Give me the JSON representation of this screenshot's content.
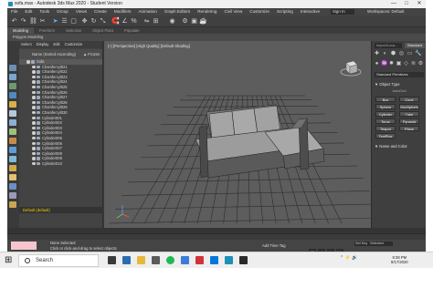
{
  "window": {
    "title": "sofa.max - Autodesk 3ds Max 2020 - Student Version",
    "controls": [
      "—",
      "□",
      "✕"
    ]
  },
  "menubar": {
    "items": [
      "File",
      "Edit",
      "Tools",
      "Group",
      "Views",
      "Create",
      "Modifiers",
      "Animation",
      "Graph Editors",
      "Rendering",
      "Civil View",
      "Customize",
      "Scripting",
      "Interactive"
    ],
    "signin": "Sign In",
    "workspace": "Workspaces: Default"
  },
  "ribbon": {
    "tabs": [
      "Modeling",
      "Freeform",
      "Selection",
      "Object Paint",
      "Populate"
    ],
    "active_tab": "Modeling",
    "panel_label": "Polygon Modeling"
  },
  "scene_explorer": {
    "tabs": [
      "Select",
      "Display",
      "Edit",
      "Customize"
    ],
    "col_name": "Name (Sorted Ascending)",
    "col_frozen": "▲ Frozen",
    "root": "Sofa",
    "items": [
      "Chamfercyl021",
      "Chamfercyl022",
      "Chamfercyl023",
      "Chamfercyl024",
      "Chamfercyl025",
      "Chamfercyl026",
      "Chamfercyl027",
      "Chamfercyl028",
      "Chamfercyl029",
      "Chamfercyl030",
      "Cylinder001",
      "Cylinder002",
      "Cylinder003",
      "Cylinder004",
      "Cylinder005",
      "Cylinder006",
      "Cylinder007",
      "Cylinder008",
      "Cylinder009",
      "Cylinder010"
    ],
    "layer": "Default (default)"
  },
  "viewport": {
    "label": "[+] [Perspective] [High Quality] [Default Shading]"
  },
  "command_panel": {
    "search": "Import/Loca...",
    "tab": "Standard",
    "dropdown": "Standard Primitives",
    "object_type": "▼ Object Type",
    "autogrid": "AutoGrid",
    "buttons": [
      "Box",
      "Cone",
      "Sphere",
      "GeoSphere",
      "Cylinder",
      "Tube",
      "Torus",
      "Pyramid",
      "Teapot",
      "Plane",
      "TextPlus"
    ],
    "name_color": "▼ Name and Color"
  },
  "status": {
    "line1": "None Selected",
    "line2": "Click or click-and-drag to select objects",
    "add_tag": "Add Time Tag",
    "set_key": "Set Key",
    "selected": "Selected"
  },
  "taskbar": {
    "search": "Search",
    "time": "9:38 PM",
    "date": "8/17/2020"
  },
  "colors": {
    "ui_bg": "#3a3a3a",
    "viewport_bg": "#5d5d5d",
    "accent_blue": "#4aa8ff",
    "layer_yellow": "#f0d000"
  }
}
